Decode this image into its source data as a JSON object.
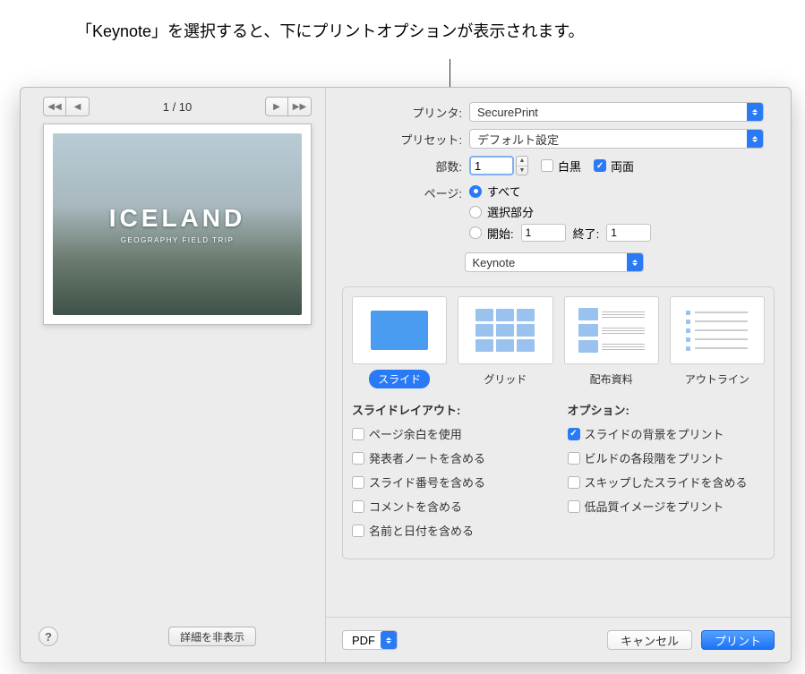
{
  "annotation": "「Keynote」を選択すると、下にプリントオプションが表示されます。",
  "preview": {
    "page_indicator": "1 / 10",
    "slide_title": "ICELAND",
    "slide_subtitle": "GEOGRAPHY FIELD TRIP"
  },
  "help_btn": "?",
  "hide_details": "詳細を非表示",
  "labels": {
    "printer": "プリンタ:",
    "preset": "プリセット:",
    "copies": "部数:",
    "pages": "ページ:",
    "bw": "白黒",
    "duplex": "両面",
    "from": "開始:",
    "to": "終了:"
  },
  "values": {
    "printer": "SecurePrint",
    "preset": "デフォルト設定",
    "copies": "1",
    "bw_checked": false,
    "duplex_checked": true,
    "from": "1",
    "to": "1"
  },
  "page_options": {
    "all": "すべて",
    "selection": "選択部分",
    "range": "開始:"
  },
  "section_select": "Keynote",
  "layouts": {
    "slide": "スライド",
    "grid": "グリッド",
    "handout": "配布資料",
    "outline": "アウトライン"
  },
  "slide_layout": {
    "heading": "スライドレイアウト:",
    "margins": "ページ余白を使用",
    "notes": "発表者ノートを含める",
    "numbers": "スライド番号を含める",
    "comments": "コメントを含める",
    "name_date": "名前と日付を含める"
  },
  "print_options": {
    "heading": "オプション:",
    "background": "スライドの背景をプリント",
    "builds": "ビルドの各段階をプリント",
    "skipped": "スキップしたスライドを含める",
    "lowres": "低品質イメージをプリント"
  },
  "footer": {
    "pdf": "PDF",
    "cancel": "キャンセル",
    "print": "プリント"
  }
}
